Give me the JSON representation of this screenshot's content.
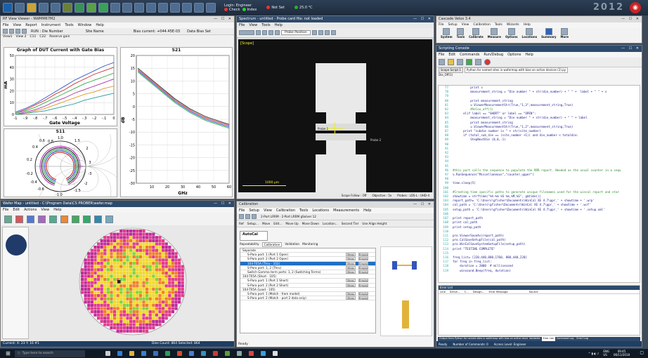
{
  "topbar": {
    "login_line1": "Login: Engineer",
    "check_label": "Check",
    "index_label": "Index",
    "not_set": "Not Set",
    "temperature": "25.0 °C"
  },
  "rf_view": {
    "title": "RF View Viewer - NWMM67M2",
    "menu": [
      "File",
      "View",
      "Report",
      "Instrument",
      "Tools",
      "Window",
      "Help"
    ],
    "toolbar_text": "RUN : Die Number",
    "site_name": "Site Name",
    "bias": "Bias current: +044.45E-03",
    "data_bias": "Data Bias Set",
    "tabs": [
      "View1",
      "View 2",
      "C11",
      "C22",
      "Reserve gain"
    ],
    "chart1": {
      "title": "Graph of DUT Current with Gate Bias",
      "ylabel": "mA",
      "xlabel": "Gate Voltage"
    },
    "chart2": {
      "title": "S21",
      "ylabel": "dB",
      "xlabel": "GHz"
    },
    "chart3": {
      "title": "S11"
    }
  },
  "chart_data": [
    {
      "type": "line",
      "title": "Graph of DUT Current with Gate Bias",
      "xlabel": "Gate Voltage",
      "ylabel": "mA",
      "xlim": [
        -1,
        0
      ],
      "ylim": [
        0,
        50
      ],
      "x_ticks": [
        "-1",
        "-.9",
        "-.8",
        "-.7",
        "-.6",
        "-.5",
        "-.4",
        "-.3",
        "-.2",
        "-.1",
        "0"
      ],
      "y_ticks": [
        "0",
        "10",
        "20",
        "30",
        "40",
        "50"
      ],
      "x": [
        -1,
        -0.9,
        -0.8,
        -0.7,
        -0.6,
        -0.5,
        -0.4,
        -0.3,
        -0.2,
        -0.1,
        0
      ],
      "series": [
        {
          "color": "#3355cc",
          "values": [
            2,
            5,
            9,
            14,
            19,
            24,
            29,
            33,
            37,
            41,
            44
          ]
        },
        {
          "color": "#cc3333",
          "values": [
            1,
            4,
            8,
            12,
            17,
            21,
            26,
            30,
            34,
            37,
            40
          ]
        },
        {
          "color": "#33aa44",
          "values": [
            1,
            3,
            6,
            10,
            14,
            18,
            22,
            26,
            29,
            32,
            35
          ]
        },
        {
          "color": "#aa33aa",
          "values": [
            0,
            2,
            4,
            7,
            11,
            14,
            18,
            21,
            24,
            27,
            30
          ]
        },
        {
          "color": "#dd9922",
          "values": [
            0,
            1,
            3,
            5,
            8,
            11,
            14,
            17,
            19,
            22,
            24
          ]
        },
        {
          "color": "#229999",
          "values": [
            0,
            1,
            2,
            3,
            5,
            7,
            9,
            12,
            14,
            16,
            18
          ]
        }
      ]
    },
    {
      "type": "line",
      "title": "S21",
      "xlabel": "GHz",
      "ylabel": "dB",
      "xlim": [
        0,
        60
      ],
      "ylim": [
        -30,
        20
      ],
      "x_ticks": [
        "10",
        "20",
        "30",
        "40",
        "50",
        "60"
      ],
      "y_ticks": [
        "20",
        "15",
        "10",
        "5",
        "0",
        "-5",
        "-10",
        "-15",
        "-20",
        "-25",
        "-30"
      ],
      "x": [
        1,
        3,
        6,
        10,
        15,
        20,
        25,
        30,
        35,
        40,
        45,
        50,
        55,
        60
      ],
      "series": [
        {
          "color": "#222222",
          "values": [
            15,
            14,
            12.5,
            10.5,
            8,
            5.5,
            3,
            1,
            -1,
            -2.5,
            -4,
            -5,
            -6,
            -7
          ]
        },
        {
          "color": "#cc2222",
          "values": [
            14.5,
            13.5,
            12,
            10,
            7.5,
            5,
            2.5,
            0.5,
            -1.5,
            -3,
            -4.5,
            -5.5,
            -6.5,
            -7.5
          ]
        },
        {
          "color": "#2244cc",
          "values": [
            14,
            13,
            11.5,
            9.5,
            7,
            4.5,
            2,
            0,
            -2,
            -3.5,
            -5,
            -6,
            -7,
            -8
          ]
        },
        {
          "color": "#22aa44",
          "values": [
            13.5,
            12.5,
            11,
            9,
            6.5,
            4,
            1.5,
            -0.5,
            -2.5,
            -4,
            -5.5,
            -6.5,
            -7.5,
            -8.5
          ]
        }
      ]
    },
    {
      "type": "scatter",
      "title": "S11",
      "axis_labels": [
        "0.6",
        "1.0",
        "1.5",
        "0.4",
        "2",
        "0.2",
        "3",
        "-0.2",
        "-3",
        "-0.4",
        "-2",
        "-0.6",
        "-1.5",
        "-1.0",
        "0.8"
      ]
    }
  ],
  "spectrum": {
    "title": "Spectrum - untitled - Probe card file: not loaded",
    "menu": [
      "File",
      "View",
      "Tools",
      "Help"
    ],
    "toolbar_probe": "Probe Position",
    "scale_note": "[Scope]",
    "scale_bar": "1000 μm",
    "probe_left": "Probe 1",
    "probe_right": "Probe 2",
    "footer": [
      "Scope Follow : Off",
      "Objective : 5x",
      "Probes : LDS-L : UHD-4"
    ]
  },
  "wafer_map": {
    "title": "Wafer Map - untitled - C:\\Program Data\\CS PROBER\\wafer.map",
    "menu": [
      "File",
      "Edit",
      "Actions",
      "View",
      "Help"
    ],
    "status": "Current: X: 23  Y: 16  #1",
    "die_count": "Dies Count: 864  Selected: 864"
  },
  "calibration": {
    "title": "Calibration",
    "menu": [
      "File",
      "Setup",
      "View",
      "Calibration",
      "Tools",
      "Locations",
      "Measurements",
      "Help"
    ],
    "tool_row2": "2-Port LRRM  ·  2-Port LRRM gSolver 12",
    "actions": [
      "Ref",
      "Setup...",
      "Move",
      "Edit...",
      "Move Up",
      "Move Down",
      "Location...",
      "Second Tier",
      "Use Align Height"
    ],
    "autocal": "AutoCal",
    "autocal_sub": "Ready",
    "tabs": [
      "Repeatability",
      "Calibration",
      "Validation",
      "Monitoring"
    ],
    "rows": [
      {
        "label": "Separate",
        "group": true
      },
      {
        "label": "S-Para port: 1 (Port 1 Open)"
      },
      {
        "label": "S-Para port: 2 (Port 2 Open)"
      },
      {
        "label": "104-T05A (Thru - 102)",
        "selected": true
      },
      {
        "label": "S-Para port: 1, 2 (Thru)"
      },
      {
        "label": "Switch Gamma term ports: 1, 2 (Switching Terms)"
      },
      {
        "label": "104-T05A (Short - 105)",
        "group": true
      },
      {
        "label": "S-Para port: 1 (Port 1 Short)"
      },
      {
        "label": "S-Para port: 2 (Port 2 Short)"
      },
      {
        "label": "104-T05A (Load - 105)",
        "group": true
      },
      {
        "label": "S-Para port: 1 (Match - from model)"
      },
      {
        "label": "S-Para port: 2 (Match - port 2 data only)"
      }
    ],
    "meas_label": "Meas",
    "empty_label": "Empty",
    "ready": "Ready"
  },
  "cascade": {
    "title": "Cascade Velox 3.4",
    "menu": [
      "File",
      "Setup",
      "View",
      "Calibration",
      "Tools",
      "Wizards",
      "Help"
    ],
    "ribbon": [
      "System",
      "Tools",
      "Calibrate",
      "Measure",
      "Options",
      "Locations",
      "Summary",
      "More"
    ]
  },
  "scripting": {
    "title": "Scripting Console",
    "menu": [
      "File",
      "Edit",
      "Commands",
      "Run/Debug",
      "Options",
      "Help"
    ],
    "tab1": "Scope Script 1",
    "tab2": "Python for named sites in wafermap with bias on active devices (2).py",
    "scope_select": "Die_Off(1)",
    "start_line": 77,
    "lines": [
      "          print s",
      "          measurement_string = \"Die number \" + str(die_number) + \" \" +  label + \" \" + s",
      "",
      "          print measurement_string",
      "          v.ViewerMeasurementStr(True,\"1,3\",measurement_string,True)",
      "          #Velox_off(1)",
      "      elif label == \"SHORT\" or label == \"OPEN\":",
      "          measurement_string = \"Die number \" + str(die_number) + \" \" + label",
      "          print measurement_string",
      "          v.ViewerMeasurementStr(True,\"1,2\",measurement_string,True)",
      "      print \"subdie number is \" + str(site_number)",
      "      if (total_sub_die == (site_number +1)) and die_number < totaldie:",
      "          StepNextDie (0,0,-1)",
      "",
      "",
      "",
      "",
      "",
      "",
      "#this part calls the sequence to populate the RRR report. Needed as the usual counter in a sequ",
      "v.RunSequence(\"Miscellaneous\",\"counter_upper\")",
      "",
      "time.sleep(5)",
      "",
      "#Creating time specific paths to generate unique filenames used for the wincal report and star",
      "showtime = strftime(\"%h-%m %S %m_%M_%S\", gmtime())",
      "report_path= 'C:\\Users\\gfisher\\Documents\\WinCal XE 4.7\\ppr_' + showtime + '.wrp'",
      "cal_path = 'C:\\Users\\gfisher\\Documents\\WinCal XE 4.7\\ppr_' + showtime + '.wcf'",
      "setup_path = 'C:\\Users\\gfisher\\Documents\\WinCal XE 4.7\\ppr_' + showtime + '.setup.xml'",
      "",
      "print report_path",
      "print cal_path",
      "print setup_path",
      "",
      "pro.ViewerSaveAs(report_path)",
      "pro.CalSaveSetupFile(cal_path)",
      "pro.WinCalSaveSystemSetupFile(setup_path)",
      "print \"TESTING COMPLETE\"",
      "",
      "freq_list= [220,440,880,1760, 880,440,220]",
      "for freq in freq_list:",
      "    duration = 2000  # millisecond",
      "    winsound.Beep(freq, duration)"
    ],
    "error_list": "Error List",
    "error_cols": [
      "Line",
      "Serve...",
      "C...",
      "Design...",
      "Error Message",
      "Source"
    ],
    "bottom_tabs": [
      "Output from Python for named sites in wafermap with bias on active devices (2).py",
      "Variables",
      "Error List",
      "Command Log",
      "Errorf Log"
    ],
    "status": [
      "Ready",
      "Number of Commands: 0",
      "Access Level: Engineer"
    ]
  },
  "taskbar": {
    "search": "Type here to search",
    "lang": "ENG",
    "region": "US",
    "time": "09:45",
    "date": "06/11/2018"
  }
}
